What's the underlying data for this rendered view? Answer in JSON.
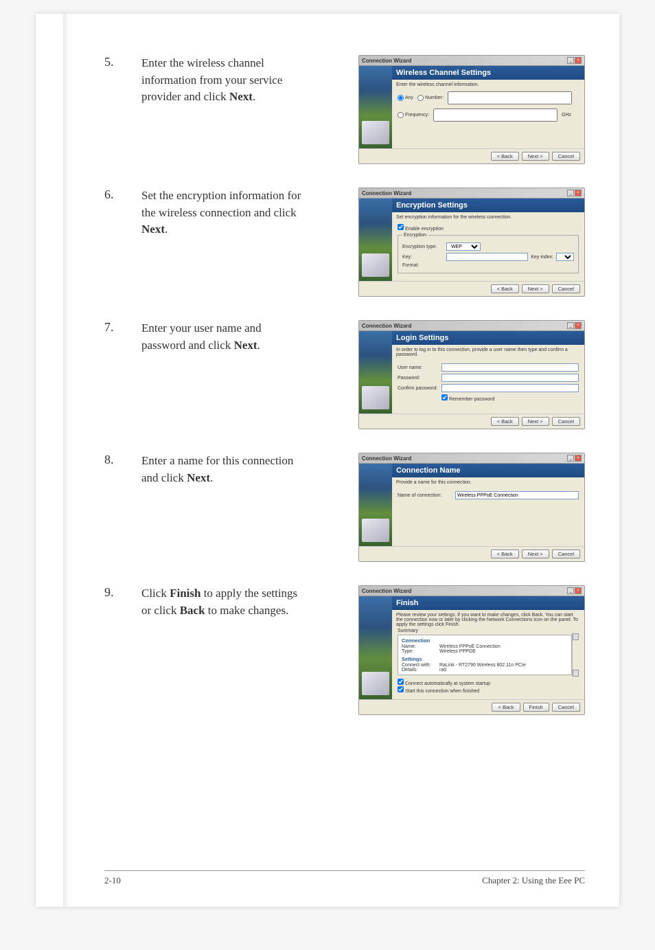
{
  "steps": [
    {
      "num": "5.",
      "html": "Enter the wireless channel information from your service provider and click <b>Next</b>."
    },
    {
      "num": "6.",
      "html": "Set the encryption information for the wireless connection and click <b>Next</b>."
    },
    {
      "num": "7.",
      "html": "Enter your user name and password and click <b>Next</b>."
    },
    {
      "num": "8.",
      "html": "Enter a name for this connection and click <b>Next</b>."
    },
    {
      "num": "9.",
      "html": "Click <b>Finish</b> to apply the settings or click <b>Back</b> to make changes."
    }
  ],
  "wizard_title": "Connection Wizard",
  "buttons": {
    "back": "< Back",
    "next": "Next >",
    "cancel": "Cancel",
    "finish": "Finish"
  },
  "step5": {
    "banner": "Wireless Channel Settings",
    "desc": "Enter the wireless channel information.",
    "any": "Any",
    "number": "Number:",
    "frequency": "Frequency:",
    "ghz": "GHz"
  },
  "step6": {
    "banner": "Encryption Settings",
    "desc": "Set encryption information for the wireless connection.",
    "enable": "Enable encryption",
    "group": "Encryption",
    "type_label": "Encryption type:",
    "type_value": "WEP",
    "key_label": "Key:",
    "key_index": "Key index:",
    "format": "Format:"
  },
  "step7": {
    "banner": "Login Settings",
    "desc": "In order to log in to this connection, provide a user name then type and confirm a password.",
    "user": "User name:",
    "password": "Password:",
    "confirm": "Confirm password:",
    "remember": "Remember password"
  },
  "step8": {
    "banner": "Connection Name",
    "desc": "Provide a name for this connection.",
    "label": "Name of connection:",
    "value": "Wireless PPPoE Connection"
  },
  "step9": {
    "banner": "Finish",
    "desc": "Please review your settings. If you want to make changes, click Back. You can start the connection now or later by clicking the Network Connections icon on the panel. To apply the settings click Finish.",
    "summary": "Summary",
    "conn_h": "Connection",
    "name_l": "Name:",
    "name_v": "Wireless PPPoE Connection",
    "type_l": "Type:",
    "type_v": "Wireless PPPOE",
    "set_h": "Settings",
    "cw_l": "Connect with:",
    "cw_v": "RaLink - RT2790 Wireless 802.11n PCIe",
    "det_l": "Details:",
    "det_v": "ra0",
    "auto": "Connect automatically at system startup",
    "start": "Start this connection when finished"
  },
  "footer": {
    "left": "2-10",
    "right": "Chapter 2: Using the Eee PC"
  }
}
